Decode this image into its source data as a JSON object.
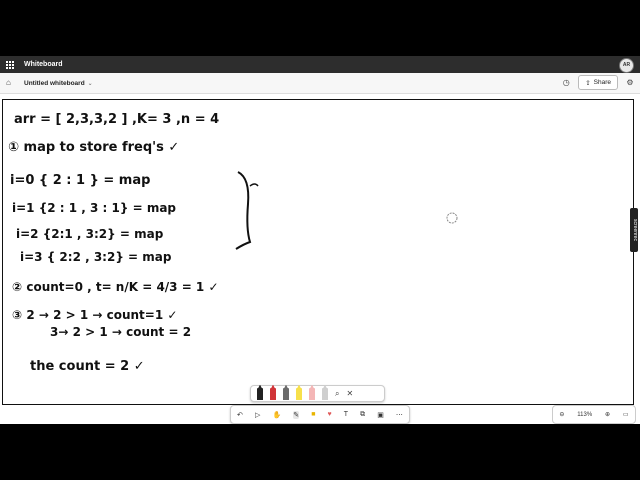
{
  "app": {
    "name": "Whiteboard",
    "avatar_initials": "AR"
  },
  "header": {
    "doc_title": "Untitled whiteboard",
    "share_label": "Share"
  },
  "recorder_badge": "screenrec",
  "whiteboard": {
    "lines": [
      "arr = [ 2,3,3,2 ] ,K= 3 ,n = 4",
      "① map to store freq's ✓",
      "i=0   { 2 : 1 } = map",
      "i=1   {2 : 1 , 3 : 1} = map",
      "i=2   {2:1 , 3:2} = map",
      "i=3   { 2:2 , 3:2} = map",
      "② count=0 , t= n/K = 4/3 = 1 ✓",
      "③  2 → 2 > 1 → count=1 ✓",
      "3→ 2 > 1 → count = 2",
      "the count = 2 ✓"
    ]
  },
  "pen_tray": {
    "colors": [
      "#222222",
      "#d13438",
      "#6b6b6b",
      "#f7e04b",
      "#f4b6b6",
      "#cfcfcf"
    ]
  },
  "toolbar": {
    "icons": [
      "undo-icon",
      "select-icon",
      "hand-icon",
      "pen-icon",
      "sticky-note-icon",
      "reaction-icon",
      "text-icon",
      "shapes-icon",
      "templates-icon",
      "more-icon"
    ]
  },
  "zoom": {
    "level": "113%"
  },
  "colors": {
    "topbar": "#2d2d2d",
    "ink": "#111111",
    "accent_red": "#d13438"
  }
}
